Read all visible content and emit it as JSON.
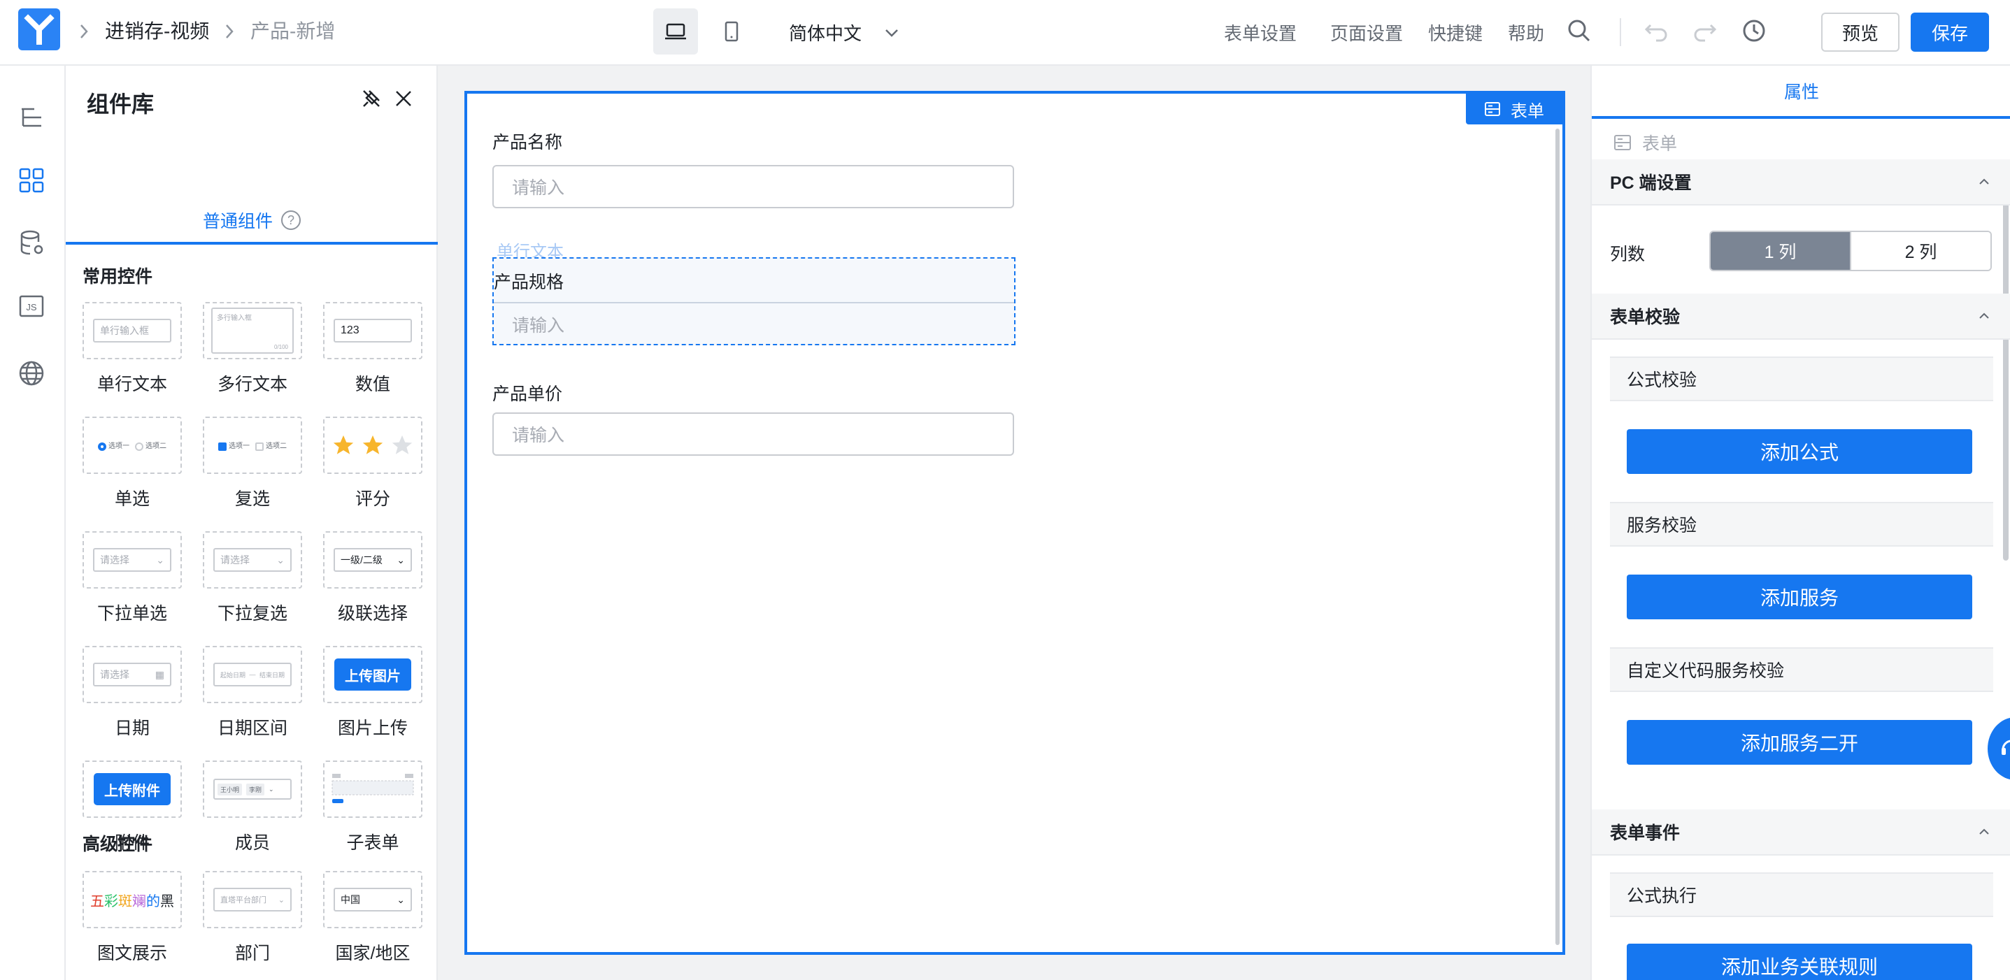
{
  "breadcrumb": {
    "app": "进销存-视频",
    "page": "产品-新增"
  },
  "header": {
    "language": "简体中文",
    "links": [
      "表单设置",
      "页面设置",
      "快捷键",
      "帮助"
    ],
    "preview_label": "预览",
    "save_label": "保存"
  },
  "library": {
    "title": "组件库",
    "tab_label": "普通组件",
    "tab_help": "?",
    "sections": {
      "common": "常用控件",
      "advanced": "高级控件"
    },
    "components": {
      "single_text": {
        "label": "单行文本",
        "preview": "单行输入框"
      },
      "multi_text": {
        "label": "多行文本",
        "preview": "多行输入框",
        "count": "0/100"
      },
      "number": {
        "label": "数值",
        "preview": "123"
      },
      "radio": {
        "label": "单选",
        "opt1": "选项一",
        "opt2": "选项二"
      },
      "checkbox": {
        "label": "复选",
        "opt1": "选项一",
        "opt2": "选项二"
      },
      "rating": {
        "label": "评分"
      },
      "select": {
        "label": "下拉单选",
        "preview": "请选择"
      },
      "multi_select": {
        "label": "下拉复选",
        "preview": "请选择"
      },
      "cascade": {
        "label": "级联选择",
        "preview": "一级/二级"
      },
      "date": {
        "label": "日期",
        "preview": "请选择"
      },
      "date_range": {
        "label": "日期区间",
        "from": "起始日期",
        "to": "结束日期"
      },
      "image_upload": {
        "label": "图片上传",
        "preview": "上传图片"
      },
      "attachment": {
        "label": "附件",
        "preview": "上传附件"
      },
      "member": {
        "label": "成员",
        "tag1": "王小明",
        "tag2": "李刚"
      },
      "subform": {
        "label": "子表单"
      },
      "rich_display": {
        "label": "图文展示",
        "preview": [
          "五",
          "彩",
          "斑",
          "斓",
          "的",
          "黑"
        ]
      },
      "department": {
        "label": "部门",
        "preview": "直塔平台部门"
      },
      "country": {
        "label": "国家/地区",
        "preview": "中国"
      }
    }
  },
  "canvas": {
    "badge": "表单",
    "fields": [
      {
        "label": "产品名称",
        "placeholder": "请输入"
      },
      {
        "label": "产品规格",
        "placeholder": "请输入"
      },
      {
        "label": "产品单价",
        "placeholder": "请输入"
      }
    ],
    "drag_ghost": "单行文本"
  },
  "props": {
    "tab": "属性",
    "selected": "表单",
    "pc_section": "PC 端设置",
    "columns_label": "列数",
    "columns_options": [
      "1 列",
      "2 列"
    ],
    "columns_selected": "1 列",
    "validation_section": "表单校验",
    "formula_validation": "公式校验",
    "add_formula": "添加公式",
    "service_validation": "服务校验",
    "add_service": "添加服务",
    "custom_code_validation": "自定义代码服务校验",
    "add_service_custom": "添加服务二开",
    "events_section": "表单事件",
    "formula_execution": "公式执行",
    "add_rule": "添加业务关联规则"
  },
  "colors": {
    "accent": "#1677f0",
    "segment_selected": "#7b8594",
    "star": "#f7b52c"
  }
}
